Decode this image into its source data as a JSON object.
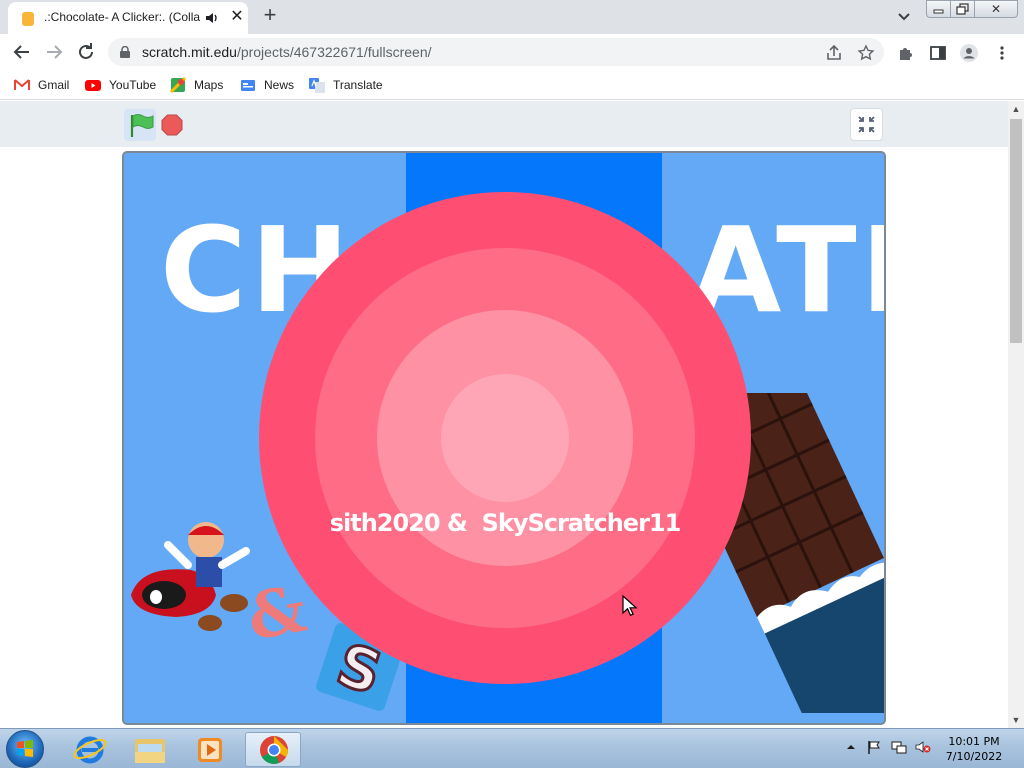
{
  "browser": {
    "tab": {
      "title": ".:Chocolate- A Clicker:. (Colla"
    },
    "address_bar": {
      "url_host": "scratch.mit.edu",
      "url_path": "/projects/467322671/fullscreen/"
    },
    "bookmarks": [
      {
        "label": "Gmail",
        "icon": "gmail-icon"
      },
      {
        "label": "YouTube",
        "icon": "youtube-icon"
      },
      {
        "label": "Maps",
        "icon": "maps-icon"
      },
      {
        "label": "News",
        "icon": "news-icon"
      },
      {
        "label": "Translate",
        "icon": "translate-icon"
      }
    ]
  },
  "stage": {
    "title_left": "CHO",
    "title_right": "ATE",
    "credits": "sith2020 &  SkyScratcher11",
    "ampersand": "&",
    "logo_letter": "S"
  },
  "colors": {
    "stage_background": "#64a9f6",
    "center_band": "#0577fb",
    "target_outer": "#fe4f72",
    "target_ring_2": "#fe6c86",
    "target_ring_3": "#fe91a4",
    "target_center": "#ffa6b6"
  },
  "taskbar": {
    "clock_time": "10:01 PM",
    "clock_date": "7/10/2022"
  }
}
